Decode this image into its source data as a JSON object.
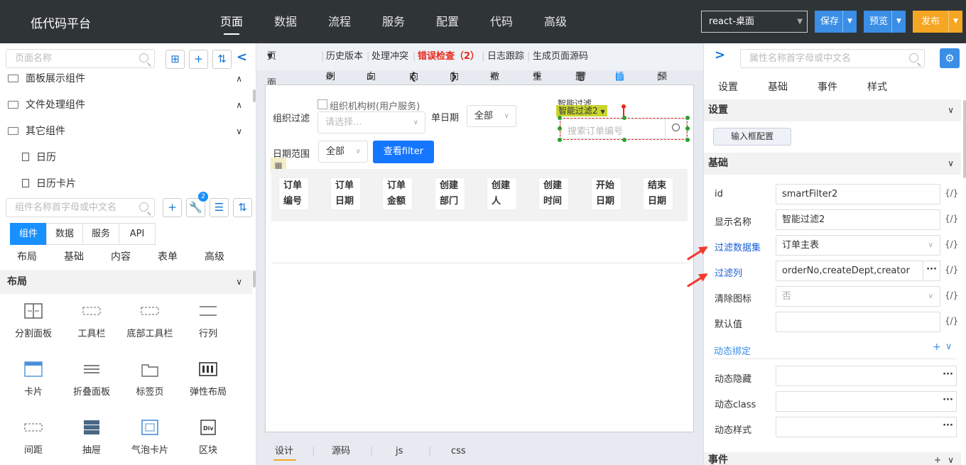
{
  "header": {
    "logo": "低代码平台",
    "nav": [
      "页面",
      "数据",
      "流程",
      "服务",
      "配置",
      "代码",
      "高级"
    ],
    "env_select": "react-桌面",
    "save": "保存",
    "preview": "预览",
    "publish": "发布"
  },
  "left": {
    "page_search_placeholder": "页面名称",
    "tree": [
      {
        "label": "面板展示组件",
        "chev": "∧"
      },
      {
        "label": "文件处理组件",
        "chev": "∧"
      },
      {
        "label": "其它组件",
        "chev": "∨"
      }
    ],
    "tree_children": [
      "日历",
      "日历卡片"
    ],
    "comp_search_placeholder": "组件名称首字母或中文名",
    "badge": "2",
    "tabs": [
      "组件",
      "数据",
      "服务",
      "API"
    ],
    "subtabs": [
      "布局",
      "基础",
      "内容",
      "表单",
      "高级"
    ],
    "section": "布局",
    "components": [
      "分割面板",
      "工具栏",
      "底部工具栏",
      "行列",
      "卡片",
      "折叠面板",
      "标签页",
      "弹性布局",
      "间距",
      "抽屉",
      "气泡卡片",
      "区块"
    ],
    "icons": [
      "split-panel-icon",
      "toolbar-icon",
      "bottom-toolbar-icon",
      "row-col-icon",
      "card-icon",
      "collapse-icon",
      "tabs-icon",
      "flex-layout-icon",
      "spacing-icon",
      "drawer-icon",
      "popover-card-icon",
      "div-block-icon"
    ]
  },
  "center": {
    "toolbar": {
      "structure": "页面结构",
      "history": "历史版本",
      "conflict": "处理冲突",
      "errors": "错误检查（2）",
      "logs": "日志跟踪",
      "gen_source": "生成页面源码"
    },
    "actions": [
      "刷新",
      "向上",
      "向前",
      "向后",
      "撤销",
      "重做",
      "删除",
      "插图",
      "预览"
    ],
    "form": {
      "org_filter_label": "组织过滤",
      "org_tree_label": "组织机构树(用户服务)",
      "org_placeholder": "请选择...",
      "order_date_label": "单日期",
      "order_date_value": "全部",
      "date_range_label": "日期范围",
      "date_range_value": "全部",
      "query_button": "查看filter",
      "smart_filter_title": "智能过滤",
      "smart_filter_tag": "智能过滤2",
      "smart_search_placeholder": "搜索订单编号"
    },
    "table_headers": [
      [
        "订单",
        "编号"
      ],
      [
        "订单",
        "日期"
      ],
      [
        "订单",
        "金额"
      ],
      [
        "创建",
        "部门"
      ],
      [
        "创建",
        "人"
      ],
      [
        "创建",
        "时间"
      ],
      [
        "开始",
        "日期"
      ],
      [
        "结束",
        "日期"
      ]
    ],
    "bottom_tabs": [
      "设计",
      "源码",
      "js",
      "css"
    ]
  },
  "right": {
    "search_placeholder": "属性名称首字母或中文名",
    "tabs": [
      "设置",
      "基础",
      "事件",
      "样式"
    ],
    "settings_section": "设置",
    "input_config_button": "输入框配置",
    "basic_section": "基础",
    "props": [
      {
        "label": "id",
        "value": "smartFilter2"
      },
      {
        "label": "显示名称",
        "value": "智能过滤2"
      },
      {
        "label": "过滤数据集",
        "value": "订单主表"
      },
      {
        "label": "过滤列",
        "value": "orderNo,createDept,creator"
      },
      {
        "label": "清除图标",
        "value": "否"
      },
      {
        "label": "默认值",
        "value": ""
      }
    ],
    "brace": "{/}",
    "dynamic_section": "动态绑定",
    "dynamic_props": [
      "动态隐藏",
      "动态class",
      "动态样式"
    ],
    "events_section": "事件",
    "colors": {
      "link": "#1a5fd8",
      "accent": "#1890ff",
      "publish": "#f5a623",
      "save": "#3a8ee6"
    }
  }
}
